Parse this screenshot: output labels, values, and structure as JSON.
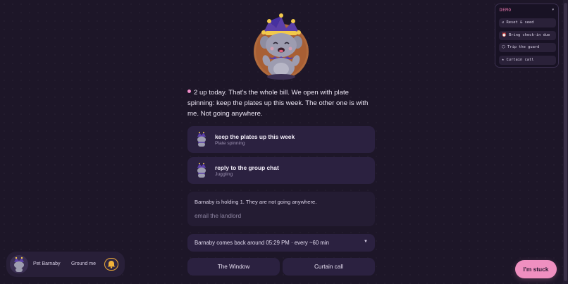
{
  "message": {
    "text": "2 up today. That's the whole bill. We open with plate spinning: keep the plates up this week. The other one is with me. Not going anywhere."
  },
  "tasks": [
    {
      "title": "keep the plates up this week",
      "subtitle": "Plate spinning"
    },
    {
      "title": "reply to the group chat",
      "subtitle": "Juggling"
    }
  ],
  "holding": {
    "text": "Barnaby is holding 1. They are not going anywhere.",
    "placeholder": "email the landlord"
  },
  "comeback": {
    "text": "Barnaby comes back around 05:29 PM · every ~60 min"
  },
  "actions": {
    "window_label": "The Window",
    "curtain_label": "Curtain call"
  },
  "bottom_bar": {
    "pet_label": "Pet Barnaby",
    "ground_label": "Ground me",
    "bell_icon": "bell-icon"
  },
  "stuck_label": "I'm stuck",
  "demo": {
    "title": "DEMO",
    "items": [
      {
        "label": "↺ Reset & seed"
      },
      {
        "label": "⏰ Bring check-in due"
      },
      {
        "label": "⬡ Trip the guard"
      },
      {
        "label": "★ Curtain call"
      }
    ]
  },
  "colors": {
    "background": "#1d1628",
    "card": "#2b2140",
    "accent_pink": "#ef8fc0",
    "bell_outline": "#e9a83a"
  }
}
